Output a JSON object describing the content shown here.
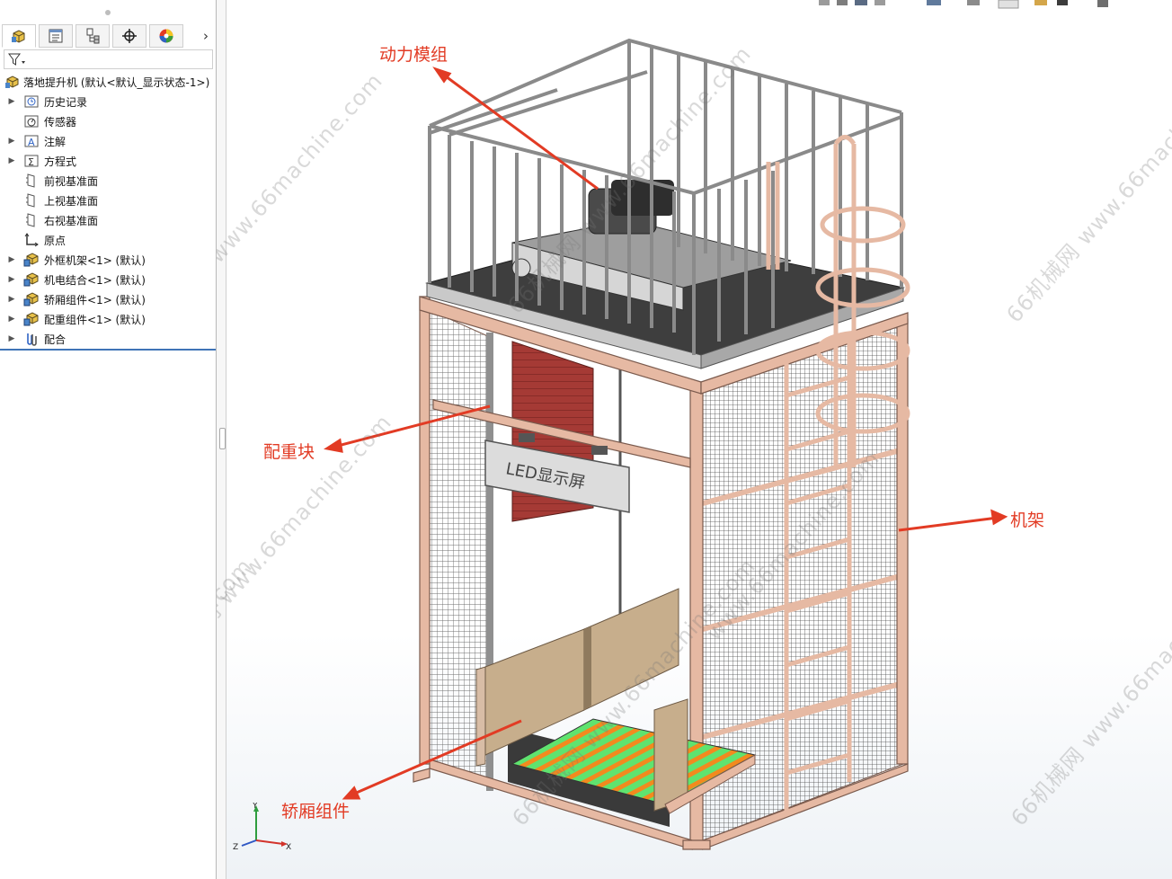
{
  "feature_tree": {
    "root": "落地提升机 (默认<默认_显示状态-1>)",
    "items": [
      {
        "label": "历史记录",
        "icon": "history-folder-icon",
        "expandable": true
      },
      {
        "label": "传感器",
        "icon": "sensor-icon",
        "expandable": false
      },
      {
        "label": "注解",
        "icon": "annotation-icon",
        "expandable": true
      },
      {
        "label": "方程式",
        "icon": "equation-icon",
        "expandable": true
      },
      {
        "label": "前视基准面",
        "icon": "plane-icon",
        "expandable": false
      },
      {
        "label": "上视基准面",
        "icon": "plane-icon",
        "expandable": false
      },
      {
        "label": "右视基准面",
        "icon": "plane-icon",
        "expandable": false
      },
      {
        "label": "原点",
        "icon": "origin-icon",
        "expandable": false
      },
      {
        "label": "外框机架<1> (默认)",
        "icon": "subassembly-icon",
        "expandable": true
      },
      {
        "label": "机电结合<1> (默认)",
        "icon": "subassembly-icon",
        "expandable": true
      },
      {
        "label": "轿厢组件<1> (默认)",
        "icon": "subassembly-icon",
        "expandable": true
      },
      {
        "label": "配重组件<1> (默认)",
        "icon": "subassembly-icon",
        "expandable": true
      },
      {
        "label": "配合",
        "icon": "mates-icon",
        "expandable": true
      }
    ]
  },
  "tabs": [
    {
      "name": "feature-manager-tab",
      "icon": "feature-tree-icon",
      "active": true
    },
    {
      "name": "property-manager-tab",
      "icon": "property-list-icon",
      "active": false
    },
    {
      "name": "configuration-manager-tab",
      "icon": "configuration-icon",
      "active": false
    },
    {
      "name": "dimxpert-tab",
      "icon": "crosshair-icon",
      "active": false
    },
    {
      "name": "display-manager-tab",
      "icon": "color-wheel-icon",
      "active": false
    }
  ],
  "model": {
    "sign_text": "LED显示屏",
    "callouts": {
      "power_module": "动力模组",
      "counterweight": "配重块",
      "frame": "机架",
      "car_assembly": "轿厢组件"
    }
  },
  "watermark": {
    "text_cn": "66机械网 www.66machine.com",
    "text_en": "www.66machine.com",
    "text_cn_short": "66机械网"
  },
  "triad": {
    "x": "X",
    "y": "Y",
    "z": "Z"
  },
  "colors": {
    "frame": "#e6b9a3",
    "frame_edge": "#7a5a4d",
    "guard": "#8a8a8a",
    "counterweight": "#a53a35",
    "car_panel": "#c7ae8c",
    "floor": "#5fe36f",
    "rollers": "#f28a1e",
    "callout": "#e23b24",
    "tree_accent": "#3f74b7"
  }
}
